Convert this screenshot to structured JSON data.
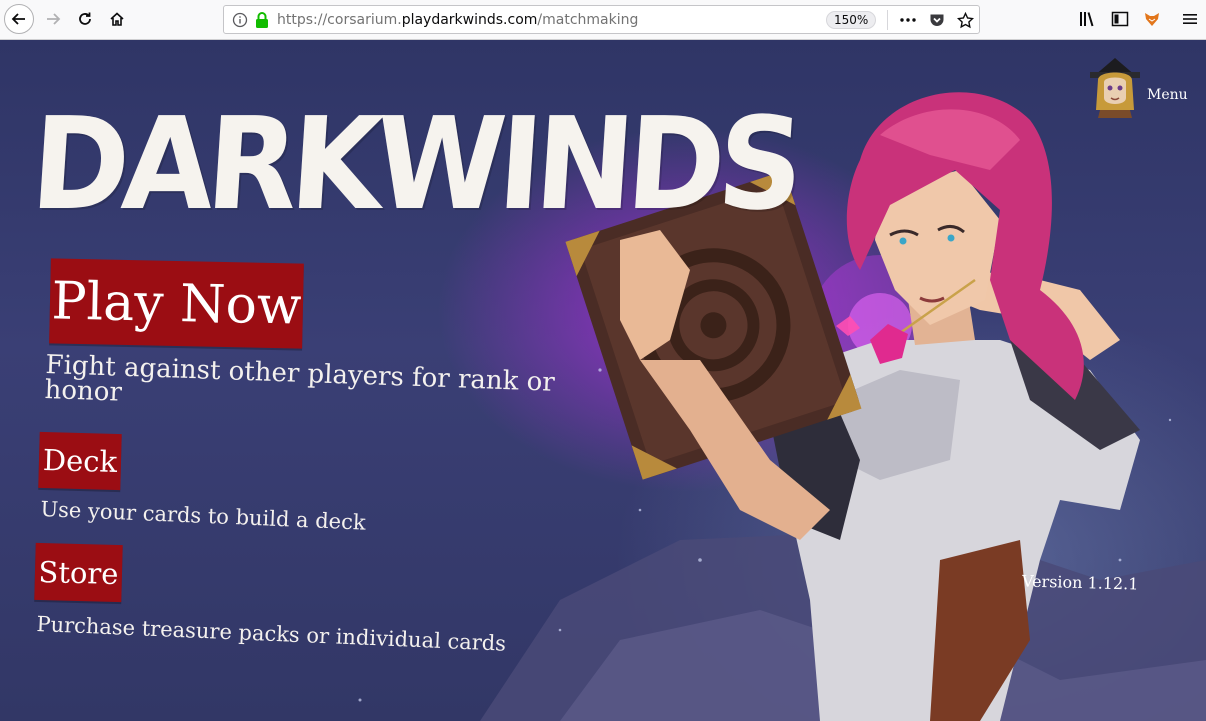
{
  "browser": {
    "url_prefix": "https://corsarium.",
    "url_domain": "playdarkwinds.com",
    "url_path": "/matchmaking",
    "zoom": "150%",
    "icons": [
      "back-icon",
      "forward-icon",
      "reload-icon",
      "home-icon",
      "info-icon",
      "lock-icon",
      "more-icon",
      "pocket-icon",
      "star-icon",
      "library-icon",
      "sidebar-icon",
      "extension-icon",
      "hamburger-icon"
    ]
  },
  "game": {
    "logo": "DARKWINDS",
    "play_button": "Play Now",
    "play_desc": "Fight against other players for rank or honor",
    "play_desc_line1": "Fight against other players for rank or",
    "play_desc_line2": "honor",
    "deck_button": "Deck",
    "deck_desc": "Use your cards to build a deck",
    "store_button": "Store",
    "store_desc": "Purchase treasure packs or individual cards",
    "menu_label": "Menu",
    "version": "Version 1.12.1"
  },
  "colors": {
    "button_red": "#9b0d13",
    "background_navy": "#323766",
    "magic_purple": "#ba2ce6",
    "hair_pink": "#c9327a"
  }
}
